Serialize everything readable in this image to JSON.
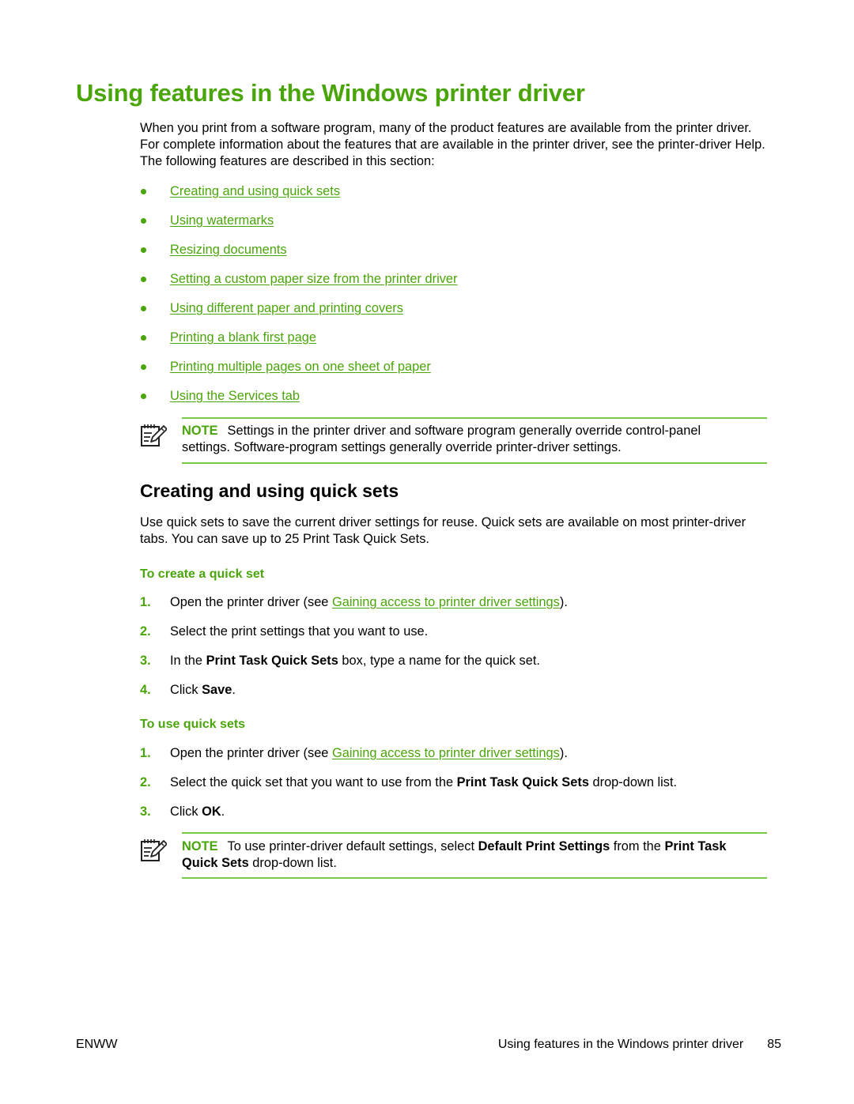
{
  "page_title": "Using features in the Windows printer driver",
  "intro": "When you print from a software program, many of the product features are available from the printer driver. For complete information about the features that are available in the printer driver, see the printer-driver Help. The following features are described in this section:",
  "feature_links": [
    {
      "label": "Creating and using quick sets"
    },
    {
      "label": "Using watermarks"
    },
    {
      "label": "Resizing documents"
    },
    {
      "label": "Setting a custom paper size from the printer driver"
    },
    {
      "label": "Using different paper and printing covers"
    },
    {
      "label": "Printing a blank first page"
    },
    {
      "label": "Printing multiple pages on one sheet of paper"
    },
    {
      "label": "Using the Services tab"
    }
  ],
  "note1": {
    "icon": "note-pencil-icon",
    "label": "NOTE",
    "text": "Settings in the printer driver and software program generally override control-panel settings. Software-program settings generally override printer-driver settings."
  },
  "section": {
    "heading": "Creating and using quick sets",
    "paragraph": "Use quick sets to save the current driver settings for reuse. Quick sets are available on most printer-driver tabs. You can save up to 25 Print Task Quick Sets."
  },
  "create_quick_set": {
    "heading": "To create a quick set",
    "steps": [
      {
        "num": "1.",
        "pre": "Open the printer driver (see ",
        "link": "Gaining access to printer driver settings",
        "post": ")."
      },
      {
        "num": "2.",
        "text": "Select the print settings that you want to use."
      },
      {
        "num": "3.",
        "pre": "In the ",
        "bold": "Print Task Quick Sets",
        "post": " box, type a name for the quick set."
      },
      {
        "num": "4.",
        "pre": "Click ",
        "bold": "Save",
        "post": "."
      }
    ]
  },
  "use_quick_sets": {
    "heading": "To use quick sets",
    "steps": [
      {
        "num": "1.",
        "pre": "Open the printer driver (see ",
        "link": "Gaining access to printer driver settings",
        "post": ")."
      },
      {
        "num": "2.",
        "pre": "Select the quick set that you want to use from the ",
        "bold": "Print Task Quick Sets",
        "post": " drop-down list."
      },
      {
        "num": "3.",
        "pre": "Click ",
        "bold": "OK",
        "post": "."
      }
    ]
  },
  "note2": {
    "icon": "note-pencil-icon",
    "label": "NOTE",
    "pre": "To use printer-driver default settings, select ",
    "bold1": "Default Print Settings",
    "mid": " from the ",
    "bold2": "Print Task Quick Sets",
    "post": " drop-down list."
  },
  "footer": {
    "left": "ENWW",
    "right_title": "Using features in the Windows printer driver",
    "page_number": "85"
  },
  "colors": {
    "accent": "#4aa50a",
    "rule": "#79c84a",
    "text": "#000000"
  }
}
